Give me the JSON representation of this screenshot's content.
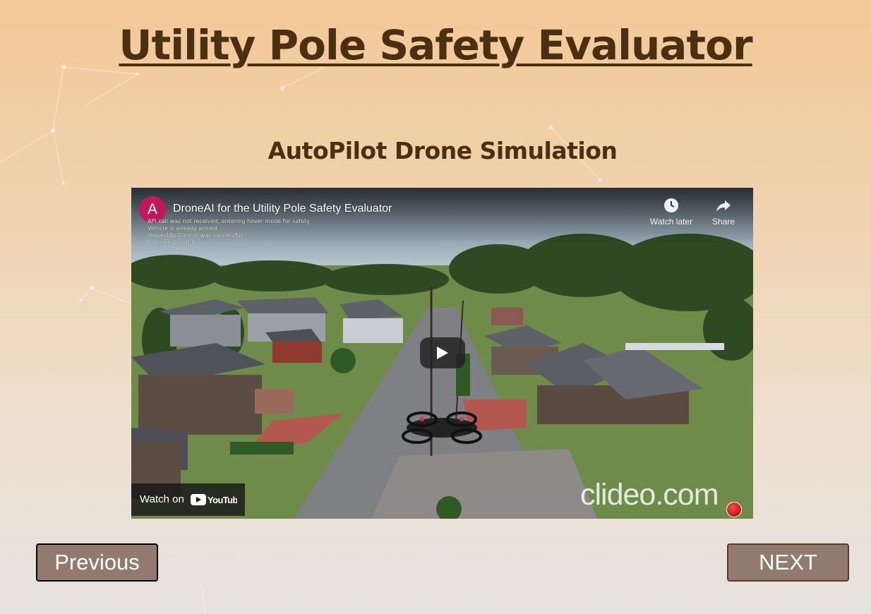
{
  "page": {
    "title": "Utility Pole Safety Evaluator",
    "subtitle": "AutoPilot Drone Simulation"
  },
  "video": {
    "channel_initial": "A",
    "title": "DroneAI for the Utility Pole Safety Evaluator",
    "log_lines": [
      "API call was not received, entering hover mode for safety",
      "Vehicle is already armed",
      "requestApiControl was successful",
      "Collision Count:0"
    ],
    "watch_later_label": "Watch later",
    "share_label": "Share",
    "watch_on_label": "Watch on",
    "youtube_logo_text": "YouTube",
    "watermark": "clideo.com",
    "rec_label": "REC"
  },
  "nav": {
    "previous_label": "Previous",
    "next_label": "NEXT"
  },
  "colors": {
    "title": "#4a2f10",
    "button_bg": "#927a6e",
    "avatar": "#c2185b"
  }
}
